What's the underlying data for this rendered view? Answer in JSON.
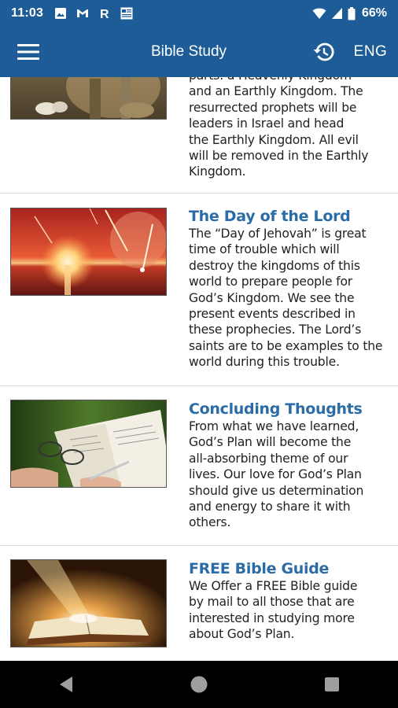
{
  "status_bar": {
    "time": "11:03",
    "battery_percent": "66%",
    "notification_icons": [
      "image-icon",
      "gmail-icon",
      "r-app-icon",
      "news-icon"
    ]
  },
  "app_bar": {
    "title": "Bible Study",
    "language": "ENG"
  },
  "lessons": [
    {
      "title": "",
      "body_lines": [
        "parts: a Heavenly Kingdom",
        "and an Earthly Kingdom. The",
        "resurrected prophets will be",
        "leaders in Israel and head",
        "the Earthly Kingdom. All evil",
        "will be removed in the Earthly",
        "Kingdom."
      ],
      "image": "biblical-scene-image"
    },
    {
      "title": "The Day of the Lord",
      "body_lines": [
        "The “Day of Jehovah” is great",
        "time of trouble which will",
        "destroy the kingdoms of this",
        "world to prepare people for",
        "God’s Kingdom. We see the",
        "present events described in",
        "these prophecies. The Lord’s",
        "saints are to be examples to the",
        "world during this trouble."
      ],
      "image": "red-sunset-sea-image"
    },
    {
      "title": "Concluding Thoughts",
      "body_lines": [
        "From what we have learned,",
        "God’s Plan will become the",
        "all-absorbing theme of our",
        "lives. Our love for God’s Plan",
        "should give us determination",
        "and energy to share it with",
        "others."
      ],
      "image": "open-bible-glasses-image"
    },
    {
      "title": "FREE Bible Guide",
      "body_lines": [
        "We Offer a FREE Bible guide",
        "by mail to all those that are",
        "interested in studying more",
        "about God’s Plan."
      ],
      "image": "glowing-bible-image"
    }
  ],
  "colors": {
    "app_bar": "#1d5c96",
    "title_text": "#2b6ca7",
    "body_text": "#222222",
    "nav_bar": "#000000"
  }
}
